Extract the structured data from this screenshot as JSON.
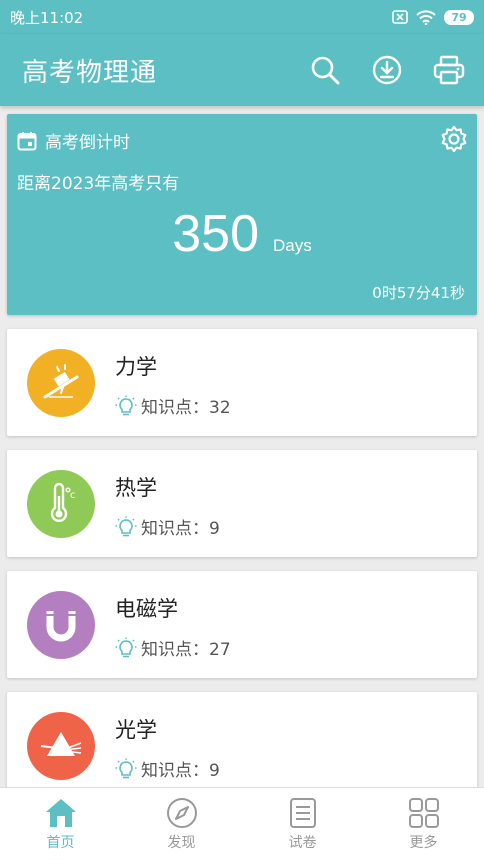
{
  "status_bar": {
    "time": "晚上11:02",
    "battery": "79"
  },
  "app_bar": {
    "title": "高考物理通"
  },
  "countdown": {
    "title": "高考倒计时",
    "subtitle": "距离2023年高考只有",
    "days": "350",
    "unit": "Days",
    "time_left": "0时57分41秒"
  },
  "subjects": [
    {
      "name": "力学",
      "points": "知识点：32",
      "color": "#f2b124",
      "icon": "slope-block-icon"
    },
    {
      "name": "热学",
      "points": "知识点：9",
      "color": "#8fca56",
      "icon": "thermometer-icon"
    },
    {
      "name": "电磁学",
      "points": "知识点：27",
      "color": "#b37fc0",
      "icon": "magnet-icon"
    },
    {
      "name": "光学",
      "points": "知识点：9",
      "color": "#ef6448",
      "icon": "prism-icon"
    }
  ],
  "nav": [
    {
      "label": "首页",
      "icon": "home-icon"
    },
    {
      "label": "发现",
      "icon": "compass-icon"
    },
    {
      "label": "试卷",
      "icon": "paper-icon"
    },
    {
      "label": "更多",
      "icon": "grid-icon"
    }
  ],
  "colors": {
    "primary": "#5bbfc4",
    "bulb": "#5bbfc4"
  }
}
